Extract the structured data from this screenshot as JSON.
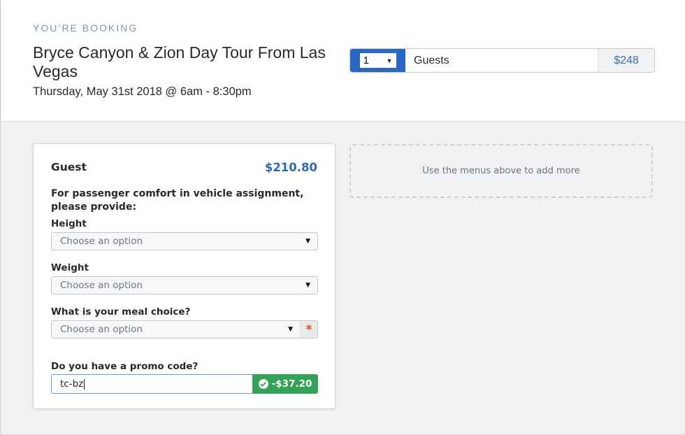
{
  "header": {
    "eyebrow": "YOU’RE BOOKING",
    "title": "Bryce Canyon & Zion Day Tour From Las Vegas",
    "date": "Thursday, May 31st 2018 @ 6am - 8:30pm"
  },
  "guest_selector": {
    "quantity": "1",
    "label": "Guests",
    "total": "$248",
    "accent_color": "#2a68c3"
  },
  "guest_card": {
    "title": "Guest",
    "price": "$210.80",
    "instructions": "For passenger comfort in vehicle assignment, please provide:",
    "fields": [
      {
        "label": "Height",
        "placeholder": "Choose an option",
        "required": false
      },
      {
        "label": "Weight",
        "placeholder": "Choose an option",
        "required": false
      },
      {
        "label": "What is your meal choice?",
        "placeholder": "Choose an option",
        "required": true,
        "required_marker": "*"
      }
    ],
    "promo": {
      "label": "Do you have a promo code?",
      "value": "tc-bz",
      "discount": "-$37.20",
      "status_icon": "check-circle-icon",
      "status_color": "#33a156"
    }
  },
  "add_more": {
    "text": "Use the menus above to add more"
  }
}
